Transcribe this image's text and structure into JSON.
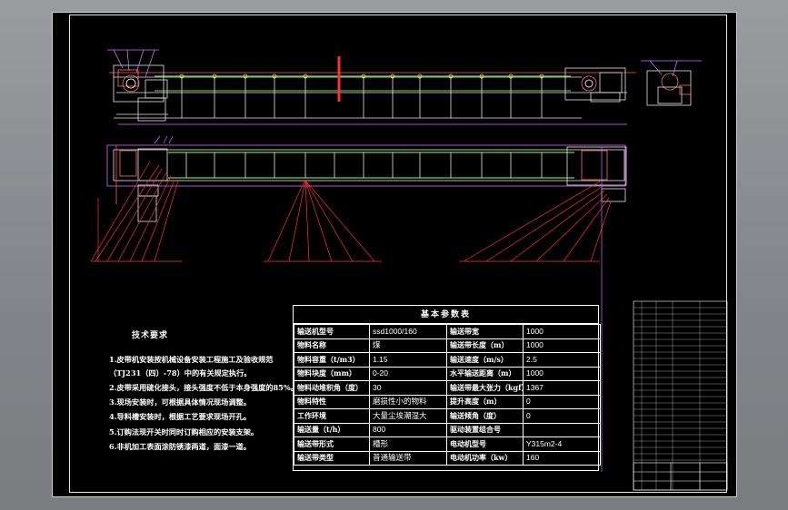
{
  "requirements": {
    "title": "技术要求",
    "lines": [
      "1.皮带机安装按机械设备安装工程施工及验收规范",
      "（TJ231（四）-78）中的有关规定执行。",
      "2.皮带采用硫化接头，接头强度不低于本身强度的85%。",
      "3.现场安装时，可根据具体情况现场调整。",
      "4.导料槽安装时，根据工艺要求现场开孔。",
      "5.订购法现开关时同时订购相应的安装支架。",
      "6.非机加工表面涂防锈漆两道，面漆一道。"
    ]
  },
  "params": {
    "title": "基本参数表",
    "rows": [
      [
        "输送机型号",
        "ssd1000/160",
        "输送带宽",
        "1000"
      ],
      [
        "物料名称",
        "煤",
        "输送带长度（m）",
        "1000"
      ],
      [
        "物料容重（t/m3）",
        "1.15",
        "输送速度（m/s）",
        "2.5"
      ],
      [
        "物料块度（mm）",
        "0-20",
        "水平输送距离（m）",
        "1000"
      ],
      [
        "物料动堆积角（度）",
        "30",
        "输送带最大张力（kgf）",
        "1367"
      ],
      [
        "物料特性",
        "磨损性小的物料",
        "提升高度（m）",
        "0"
      ],
      [
        "工作环境",
        "大量尘埃潮湿大",
        "输送倾角（度）",
        "0"
      ],
      [
        "输送量（t/h）",
        "800",
        "驱动装置组合号",
        ""
      ],
      [
        "输送带形式",
        "槽形",
        "电动机型号",
        "Y315m2-4"
      ],
      [
        "输送带类型",
        "普通输送带",
        "电动机功率（kw）",
        "160"
      ]
    ]
  }
}
